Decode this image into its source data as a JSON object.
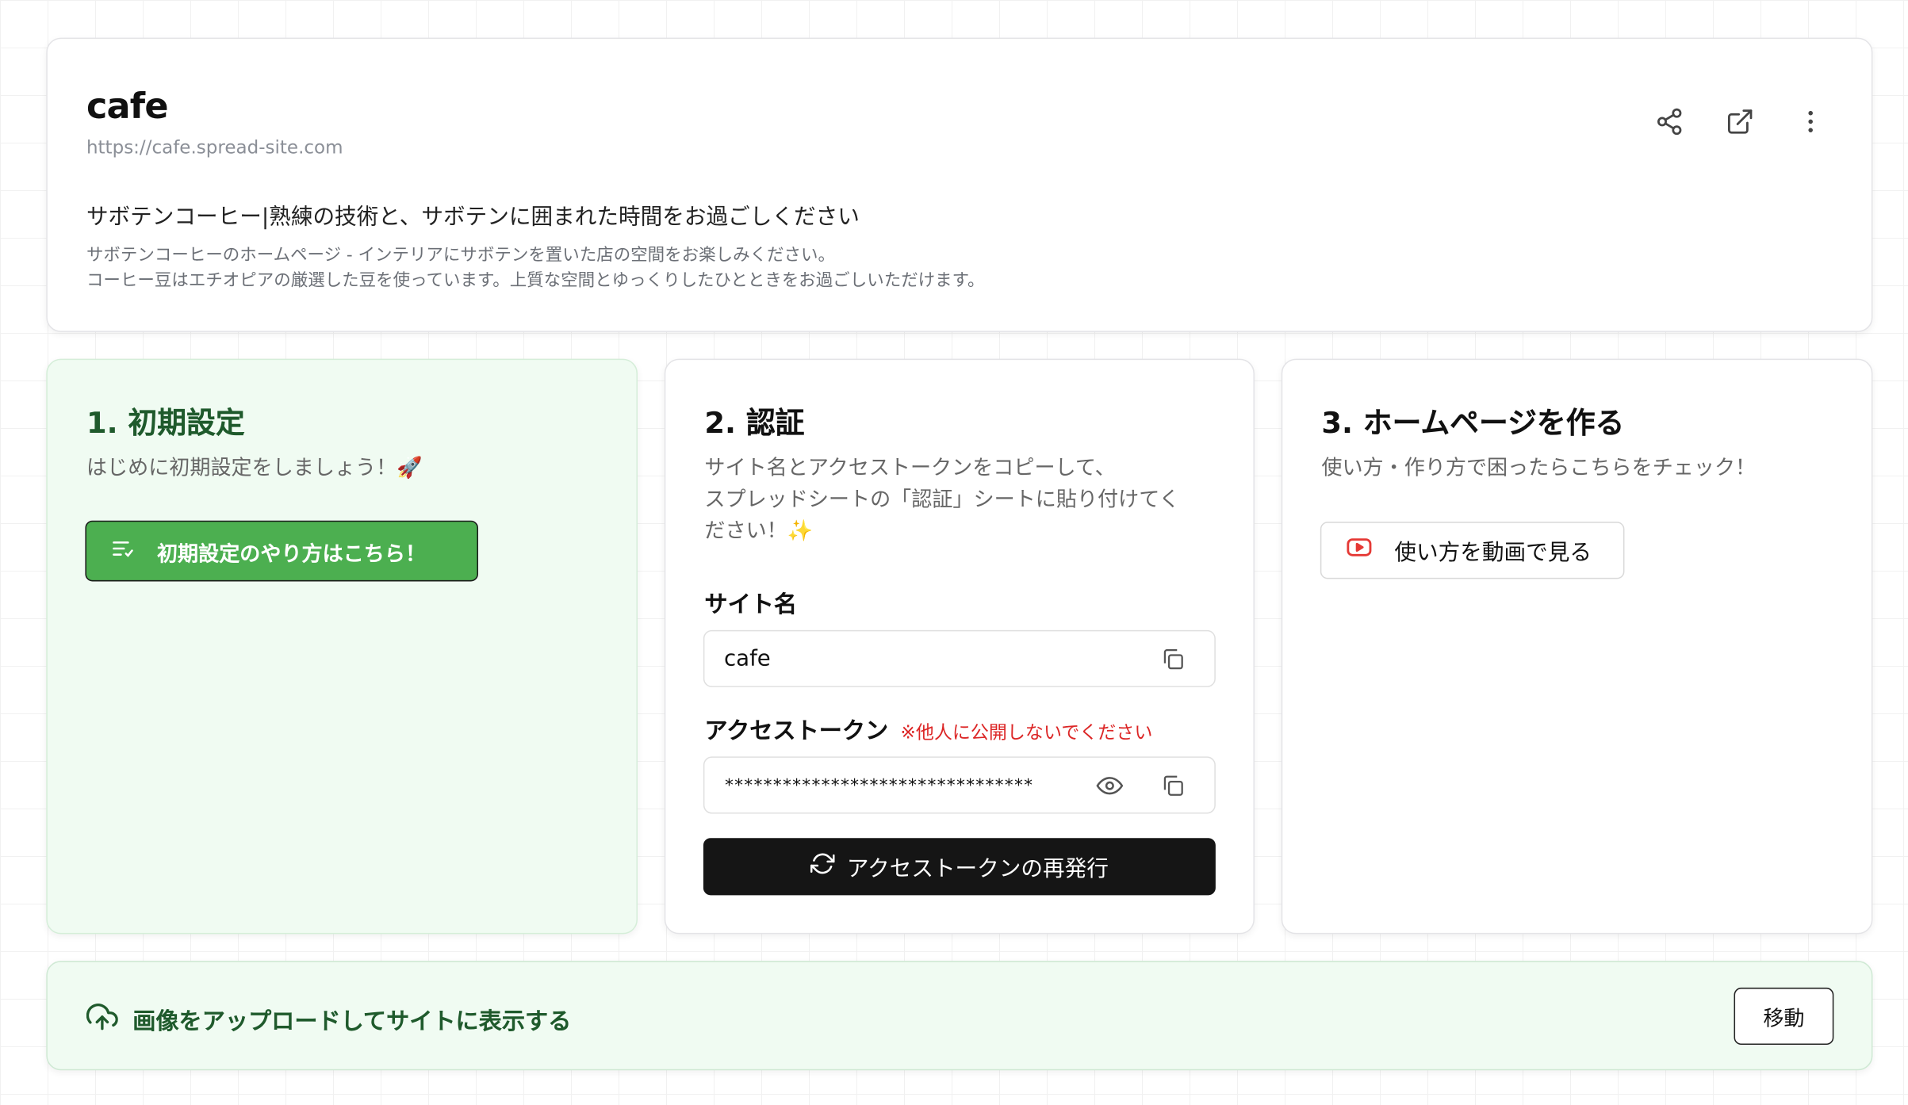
{
  "site": {
    "name": "cafe",
    "url": "https://cafe.spread-site.com",
    "heading": "サボテンコーヒー|熟練の技術と、サボテンに囲まれた時間をお過ごしください",
    "description_line1": "サボテンコーヒーのホームページ - インテリアにサボテンを置いた店の空間をお楽しみください。",
    "description_line2": "コーヒー豆はエチオピアの厳選した豆を使っています。上質な空間とゆっくりしたひとときをお過ごしいただけます。"
  },
  "header_actions": [
    "share-icon",
    "external-link-icon",
    "more-vertical-icon"
  ],
  "step1": {
    "title": "1. 初期設定",
    "subtitle": "はじめに初期設定をしましょう！🚀",
    "button_label": "初期設定のやり方はこちら！"
  },
  "step2": {
    "title": "2. 認証",
    "subtitle_line1": "サイト名とアクセストークンをコピーして、",
    "subtitle_line2": "スプレッドシートの「認証」シートに貼り付けてく",
    "subtitle_line3": "ださい！✨",
    "site_name_label": "サイト名",
    "site_name_value": "cafe",
    "token_label": "アクセストークン",
    "token_warning": "※他人に公開しないでください",
    "token_value": "********************************",
    "reissue_label": "アクセストークンの再発行"
  },
  "step3": {
    "title": "3. ホームページを作る",
    "subtitle": "使い方・作り方で困ったらこちらをチェック！",
    "video_button_label": "使い方を動画で見る"
  },
  "upload": {
    "label": "画像をアップロードしてサイトに表示する",
    "move_label": "移動"
  },
  "colors": {
    "green": "#4caf50",
    "dark_green": "#1f5a2c",
    "light_green_bg": "#f0fbf2",
    "warning_red": "#dc2626",
    "youtube_red": "#e53935"
  }
}
